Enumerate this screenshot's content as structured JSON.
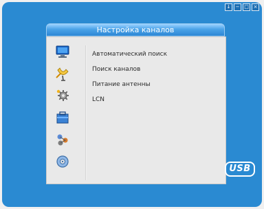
{
  "window_controls": [
    "↓",
    "−",
    "□",
    "×"
  ],
  "title": "Настройка каналов",
  "menu": {
    "icons": [
      "monitor-icon",
      "satellite-dish-icon",
      "gear-icon",
      "folder-icon",
      "network-icon",
      "disc-icon"
    ],
    "items": [
      {
        "label": "Автоматический поиск"
      },
      {
        "label": "Поиск каналов"
      },
      {
        "label": "Питание антенны"
      },
      {
        "label": "LCN"
      }
    ]
  },
  "usb_badge": "USB",
  "colors": {
    "background": "#2a8ad2",
    "panel": "#e9e9e9",
    "title_bar": "#2d86d4"
  }
}
